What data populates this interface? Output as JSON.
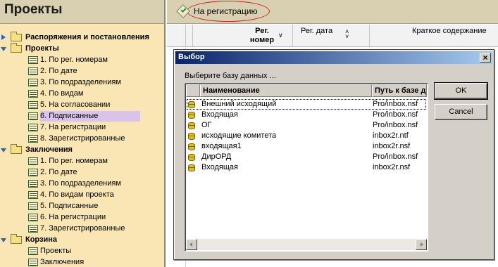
{
  "left_pane": {
    "title": "Проекты",
    "tree": [
      {
        "label": "Распоряжения и постановления",
        "level": 0,
        "kind": "folder",
        "expanded": false,
        "bold": true
      },
      {
        "label": "Проекты",
        "level": 0,
        "kind": "folder",
        "expanded": true,
        "bold": true
      },
      {
        "label": "1. По рег. номерам",
        "level": 1,
        "kind": "view"
      },
      {
        "label": "2. По дате",
        "level": 1,
        "kind": "view"
      },
      {
        "label": "3. По подразделениям",
        "level": 1,
        "kind": "view"
      },
      {
        "label": "4. По видам",
        "level": 1,
        "kind": "view"
      },
      {
        "label": "5. На согласовании",
        "level": 1,
        "kind": "view"
      },
      {
        "label": "6. Подписанные",
        "level": 1,
        "kind": "view",
        "selected": true
      },
      {
        "label": "7. На регистрации",
        "level": 1,
        "kind": "view"
      },
      {
        "label": "8. Зарегистрированные",
        "level": 1,
        "kind": "view"
      },
      {
        "label": "Заключения",
        "level": 0,
        "kind": "folder",
        "expanded": true,
        "bold": true
      },
      {
        "label": "1. По рег. номерам",
        "level": 1,
        "kind": "view"
      },
      {
        "label": "2. По дате",
        "level": 1,
        "kind": "view"
      },
      {
        "label": "3. По подразделениям",
        "level": 1,
        "kind": "view"
      },
      {
        "label": "4. По видам проекта",
        "level": 1,
        "kind": "view"
      },
      {
        "label": "5. Подписанные",
        "level": 1,
        "kind": "view"
      },
      {
        "label": "6. На регистрации",
        "level": 1,
        "kind": "view"
      },
      {
        "label": "7. Зарегистрированные",
        "level": 1,
        "kind": "view"
      },
      {
        "label": "Корзина",
        "level": 0,
        "kind": "folder",
        "expanded": true,
        "bold": true
      },
      {
        "label": "Проекты",
        "level": 1,
        "kind": "view"
      },
      {
        "label": "Заключения",
        "level": 1,
        "kind": "view"
      }
    ]
  },
  "toolbar": {
    "register_button_label": "На регистрацию",
    "register_icon": "register-icon",
    "highlight_color": "#d32020"
  },
  "view_columns": {
    "reg_number": "Рег.\nномер",
    "reg_date": "Рег. дата",
    "summary": "Краткое содержание"
  },
  "dialog": {
    "title": "Выбор",
    "prompt": "Выберите базу данных ...",
    "columns": {
      "name": "Наименование",
      "path": "Путь к базе д"
    },
    "rows": [
      {
        "name": "Внешний исходящий",
        "path": "Pro/inbox.nsf",
        "focused": true
      },
      {
        "name": "Входящая",
        "path": "Pro/inbox.nsf"
      },
      {
        "name": "ОГ",
        "path": "Pro/inbox.nsf"
      },
      {
        "name": "исходящие комитета",
        "path": "inbox2r.ntf"
      },
      {
        "name": "входящая1",
        "path": "inbox2r.nsf"
      },
      {
        "name": "ДирОРД",
        "path": "Pro/inbox.nsf"
      },
      {
        "name": "Входящая",
        "path": "inbox2r.nsf"
      }
    ],
    "ok_label": "OK",
    "cancel_label": "Cancel",
    "close_glyph": "×"
  }
}
